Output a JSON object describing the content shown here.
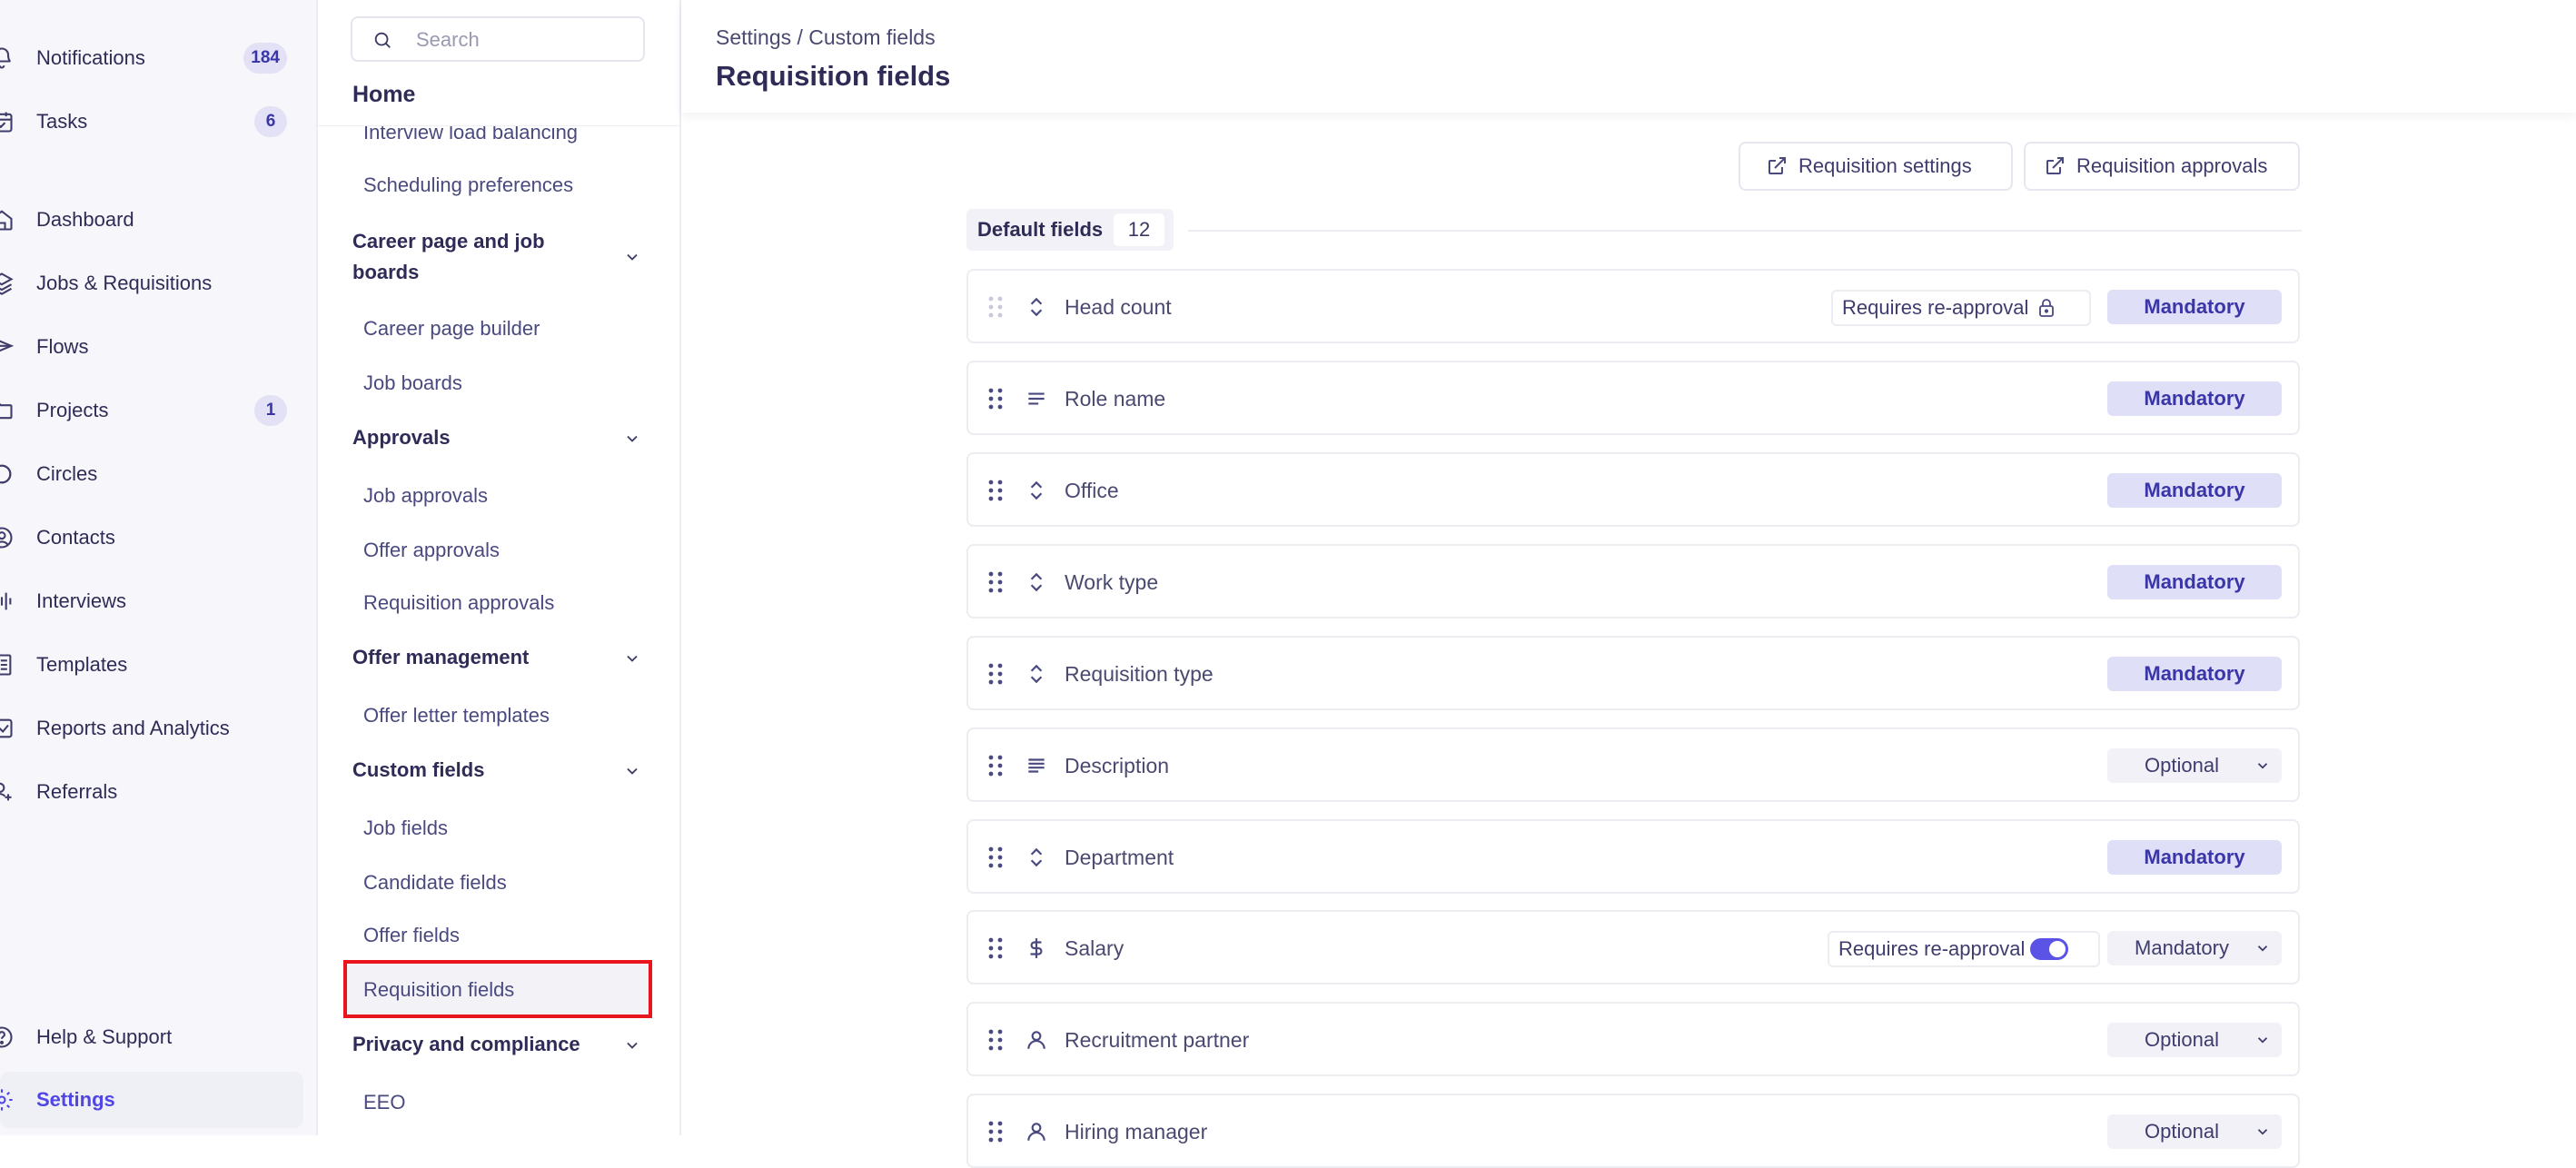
{
  "nav": {
    "items": [
      {
        "label": "Notifications",
        "badge": "184",
        "icon": "bell-icon"
      },
      {
        "label": "Tasks",
        "badge": "6",
        "icon": "calendar-check-icon"
      },
      {
        "label": "Dashboard",
        "badge": "",
        "icon": "home-icon"
      },
      {
        "label": "Jobs & Requisitions",
        "badge": "",
        "icon": "layers-icon"
      },
      {
        "label": "Flows",
        "badge": "",
        "icon": "send-icon"
      },
      {
        "label": "Projects",
        "badge": "1",
        "icon": "folder-icon"
      },
      {
        "label": "Circles",
        "badge": "",
        "icon": "circles-icon"
      },
      {
        "label": "Contacts",
        "badge": "",
        "icon": "contacts-icon"
      },
      {
        "label": "Interviews",
        "badge": "",
        "icon": "audio-wave-icon"
      },
      {
        "label": "Templates",
        "badge": "",
        "icon": "book-icon"
      },
      {
        "label": "Reports and Analytics",
        "badge": "",
        "icon": "chart-icon"
      },
      {
        "label": "Referrals",
        "badge": "",
        "icon": "user-plus-icon"
      }
    ],
    "help_label": "Help & Support",
    "settings_label": "Settings"
  },
  "settings_nav": {
    "search_placeholder": "Search",
    "home_title": "Home",
    "partial_item": "Interview load balancing",
    "scheduling": "Scheduling preferences",
    "career_head": "Career page and job boards",
    "career_builder": "Career page builder",
    "job_boards": "Job boards",
    "approvals_head": "Approvals",
    "job_approvals": "Job approvals",
    "offer_approvals": "Offer approvals",
    "requisition_approvals": "Requisition approvals",
    "offer_mgmt_head": "Offer management",
    "offer_letter_templates": "Offer letter templates",
    "custom_fields_head": "Custom fields",
    "job_fields": "Job fields",
    "candidate_fields": "Candidate fields",
    "offer_fields": "Offer fields",
    "requisition_fields": "Requisition fields",
    "privacy_head": "Privacy and compliance",
    "eeo": "EEO"
  },
  "header": {
    "breadcrumb": "Settings / Custom fields",
    "title": "Requisition fields"
  },
  "actions": {
    "requisition_settings": "Requisition settings",
    "requisition_approvals": "Requisition approvals"
  },
  "section": {
    "label": "Default fields",
    "count": "12"
  },
  "fields": [
    {
      "name": "Head count",
      "type_icon": "sort-arrows-icon",
      "status": "Mandatory",
      "reapproval": "Requires re-approval",
      "locked": true
    },
    {
      "name": "Role name",
      "type_icon": "short-text-icon",
      "status": "Mandatory"
    },
    {
      "name": "Office",
      "type_icon": "sort-arrows-icon",
      "status": "Mandatory"
    },
    {
      "name": "Work type",
      "type_icon": "sort-arrows-icon",
      "status": "Mandatory"
    },
    {
      "name": "Requisition type",
      "type_icon": "sort-arrows-icon",
      "status": "Mandatory"
    },
    {
      "name": "Description",
      "type_icon": "long-text-icon",
      "status": "Optional"
    },
    {
      "name": "Department",
      "type_icon": "sort-arrows-icon",
      "status": "Mandatory"
    },
    {
      "name": "Salary",
      "type_icon": "dollar-icon",
      "status": "Mandatory",
      "reapproval": "Requires re-approval",
      "toggle_on": true
    },
    {
      "name": "Recruitment partner",
      "type_icon": "user-icon",
      "status": "Optional"
    },
    {
      "name": "Hiring manager",
      "type_icon": "user-icon",
      "status": "Optional"
    }
  ],
  "colors": {
    "accent": "#4f46e5",
    "mandatory_bg": "#e0dff8",
    "highlight_border": "#e8141e"
  }
}
